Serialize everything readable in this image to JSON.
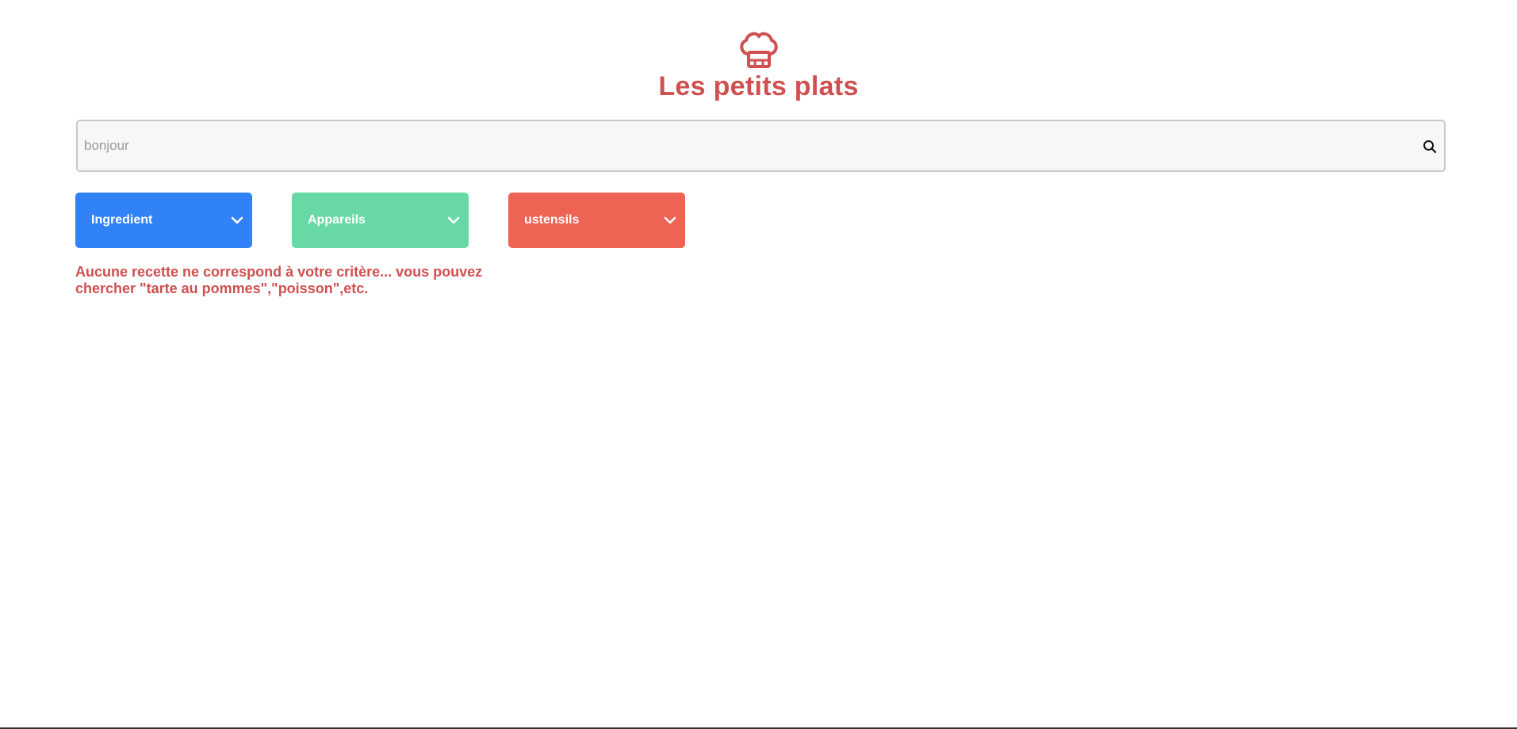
{
  "header": {
    "logo_icon": "chef-hat-icon",
    "title": "Les petits plats",
    "brand_color": "#D04F4F"
  },
  "search": {
    "value": "bonjour",
    "icon": "search-icon"
  },
  "filters": [
    {
      "label": "Ingredient",
      "color": "#3282F7",
      "icon": "chevron-down-icon"
    },
    {
      "label": "Appareils",
      "color": "#68D9A4",
      "icon": "chevron-down-icon"
    },
    {
      "label": "ustensils",
      "color": "#ED6454",
      "icon": "chevron-down-icon"
    }
  ],
  "results": {
    "empty_message": "Aucune recette ne correspond à votre critère... vous pouvez chercher \"tarte au pommes\",\"poisson\",etc."
  }
}
